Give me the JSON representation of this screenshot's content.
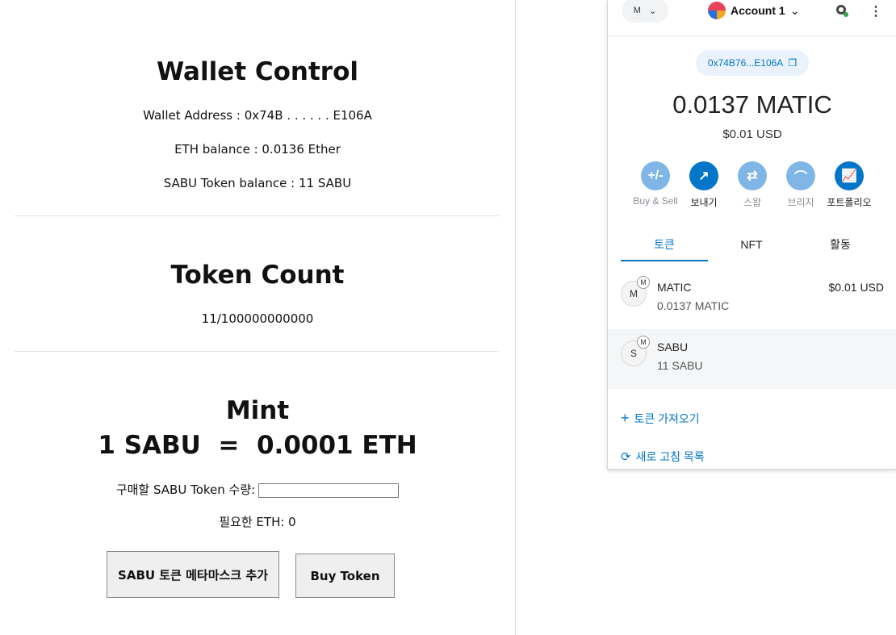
{
  "wallet_control": {
    "title": "Wallet Control",
    "address_line": "Wallet Address : 0x74B . . . . . . E106A",
    "eth_balance_line": "ETH balance : 0.0136 Ether",
    "token_balance_line": "SABU Token balance : 11 SABU"
  },
  "token_count": {
    "title": "Token Count",
    "value": "11/100000000000"
  },
  "mint": {
    "title": "Mint",
    "rate": "1 SABU  =  0.0001 ETH",
    "quantity_label": "구매할 SABU Token 수량:",
    "quantity_value": "",
    "required_eth": "필요한 ETH: 0",
    "add_to_metamask_label": "SABU 토큰 메타마스크 추가",
    "buy_label": "Buy Token"
  },
  "metamask": {
    "network_label": "M",
    "account_name": "Account 1",
    "address_short": "0x74B76...E106A",
    "balance": "0.0137 MATIC",
    "balance_usd": "$0.01 USD",
    "actions": [
      {
        "label": "Buy & Sell",
        "icon": "buy-sell-icon",
        "glyph": "+/-",
        "color": "#7fb6e6",
        "muted": true
      },
      {
        "label": "보내기",
        "icon": "send-icon",
        "glyph": "↗",
        "color": "#0376c9",
        "muted": false
      },
      {
        "label": "스왑",
        "icon": "swap-icon",
        "glyph": "⇄",
        "color": "#7fb6e6",
        "muted": true
      },
      {
        "label": "브리지",
        "icon": "bridge-icon",
        "glyph": "⌒",
        "color": "#7fb6e6",
        "muted": true
      },
      {
        "label": "포트폴리오",
        "icon": "portfolio-icon",
        "glyph": "📈",
        "color": "#0376c9",
        "muted": false
      }
    ],
    "tabs": [
      "토큰",
      "NFT",
      "활동"
    ],
    "tokens": [
      {
        "avatar": "M",
        "badge": "M",
        "name": "MATIC",
        "amount": "0.0137 MATIC",
        "value": "$0.01 USD"
      },
      {
        "avatar": "S",
        "badge": "M",
        "name": "SABU",
        "amount": "11 SABU",
        "value": ""
      }
    ],
    "import_tokens_label": "토큰 가져오기",
    "refresh_list_label": "새로 고침 목록",
    "colors": {
      "accent": "#0376c9",
      "muted_action": "#7fb6e6"
    }
  }
}
